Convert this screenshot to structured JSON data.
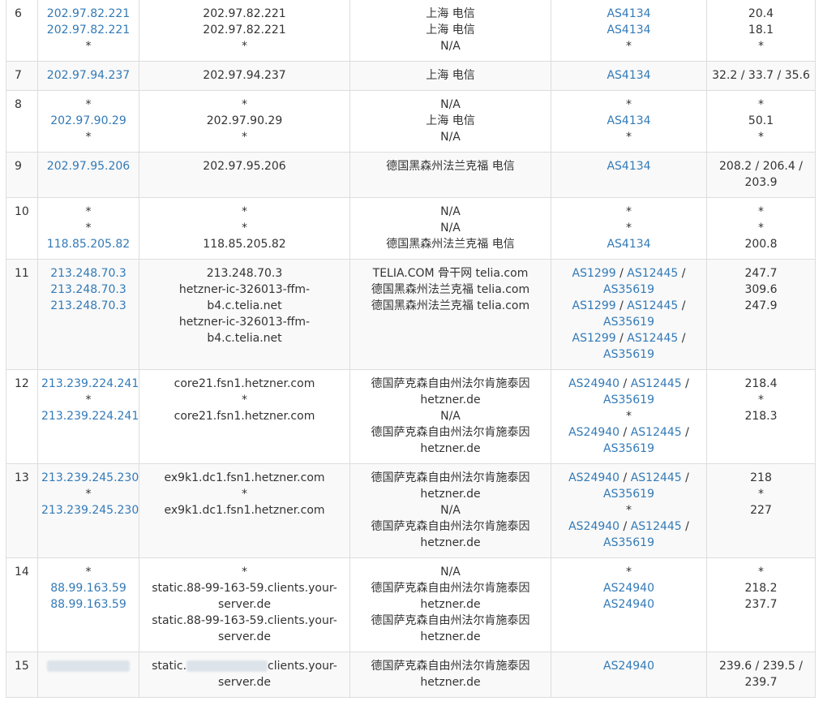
{
  "rows": [
    {
      "hop": "6",
      "ip": [
        {
          "t": "202.97.82.221",
          "link": true
        },
        {
          "t": "202.97.82.221",
          "link": true
        },
        {
          "t": "*"
        }
      ],
      "host": [
        "202.97.82.221",
        "202.97.82.221",
        "*"
      ],
      "loc": [
        "上海 电信",
        "上海 电信",
        "N/A"
      ],
      "asn": [
        [
          {
            "t": "AS4134",
            "link": true
          }
        ],
        [
          {
            "t": "AS4134",
            "link": true
          }
        ],
        [
          {
            "t": "*"
          }
        ]
      ],
      "time": [
        "20.4",
        "18.1",
        "*"
      ]
    },
    {
      "hop": "7",
      "ip": [
        {
          "t": "202.97.94.237",
          "link": true
        }
      ],
      "host": [
        "202.97.94.237"
      ],
      "loc": [
        "上海 电信"
      ],
      "asn": [
        [
          {
            "t": "AS4134",
            "link": true
          }
        ]
      ],
      "time": [
        "32.2 / 33.7 / 35.6"
      ]
    },
    {
      "hop": "8",
      "ip": [
        {
          "t": "*"
        },
        {
          "t": "202.97.90.29",
          "link": true
        },
        {
          "t": "*"
        }
      ],
      "host": [
        "*",
        "202.97.90.29",
        "*"
      ],
      "loc": [
        "N/A",
        "上海 电信",
        "N/A"
      ],
      "asn": [
        [
          {
            "t": "*"
          }
        ],
        [
          {
            "t": "AS4134",
            "link": true
          }
        ],
        [
          {
            "t": "*"
          }
        ]
      ],
      "time": [
        "*",
        "50.1",
        "*"
      ]
    },
    {
      "hop": "9",
      "ip": [
        {
          "t": "202.97.95.206",
          "link": true
        }
      ],
      "host": [
        "202.97.95.206"
      ],
      "loc": [
        "德国黑森州法兰克福 电信"
      ],
      "asn": [
        [
          {
            "t": "AS4134",
            "link": true
          }
        ]
      ],
      "time": [
        "208.2 / 206.4 /",
        "203.9"
      ]
    },
    {
      "hop": "10",
      "ip": [
        {
          "t": "*"
        },
        {
          "t": "*"
        },
        {
          "t": "118.85.205.82",
          "link": true
        }
      ],
      "host": [
        "*",
        "*",
        "118.85.205.82"
      ],
      "loc": [
        "N/A",
        "N/A",
        "德国黑森州法兰克福 电信"
      ],
      "asn": [
        [
          {
            "t": "*"
          }
        ],
        [
          {
            "t": "*"
          }
        ],
        [
          {
            "t": "AS4134",
            "link": true
          }
        ]
      ],
      "time": [
        "*",
        "*",
        "200.8"
      ]
    },
    {
      "hop": "11",
      "ip": [
        {
          "t": "213.248.70.3",
          "link": true
        },
        {
          "t": "213.248.70.3",
          "link": true
        },
        {
          "t": "213.248.70.3",
          "link": true
        }
      ],
      "host": [
        "213.248.70.3",
        "hetzner-ic-326013-ffm-b4.c.telia.net",
        "hetzner-ic-326013-ffm-b4.c.telia.net"
      ],
      "loc": [
        "TELIA.COM 骨干网 telia.com",
        "德国黑森州法兰克福 telia.com",
        "德国黑森州法兰克福 telia.com"
      ],
      "asn": [
        [
          {
            "t": "AS1299",
            "link": true
          },
          {
            "t": " / "
          },
          {
            "t": "AS12445",
            "link": true
          },
          {
            "t": " /"
          }
        ],
        [
          {
            "t": "AS35619",
            "link": true
          }
        ],
        [
          {
            "t": "AS1299",
            "link": true
          },
          {
            "t": " / "
          },
          {
            "t": "AS12445",
            "link": true
          },
          {
            "t": " /"
          }
        ],
        [
          {
            "t": "AS35619",
            "link": true
          }
        ],
        [
          {
            "t": "AS1299",
            "link": true
          },
          {
            "t": " / "
          },
          {
            "t": "AS12445",
            "link": true
          },
          {
            "t": " /"
          }
        ],
        [
          {
            "t": "AS35619",
            "link": true
          }
        ]
      ],
      "time": [
        "247.7",
        "309.6",
        "247.9"
      ]
    },
    {
      "hop": "12",
      "ip": [
        {
          "t": "213.239.224.241",
          "link": true
        },
        {
          "t": "*"
        },
        {
          "t": "213.239.224.241",
          "link": true
        }
      ],
      "host": [
        "core21.fsn1.hetzner.com",
        "*",
        "core21.fsn1.hetzner.com"
      ],
      "loc": [
        "德国萨克森自由州法尔肯施泰因",
        "hetzner.de",
        "N/A",
        "德国萨克森自由州法尔肯施泰因",
        "hetzner.de"
      ],
      "asn": [
        [
          {
            "t": "AS24940",
            "link": true
          },
          {
            "t": " / "
          },
          {
            "t": "AS12445",
            "link": true
          },
          {
            "t": " /"
          }
        ],
        [
          {
            "t": "AS35619",
            "link": true
          }
        ],
        [
          {
            "t": "*"
          }
        ],
        [
          {
            "t": "AS24940",
            "link": true
          },
          {
            "t": " / "
          },
          {
            "t": "AS12445",
            "link": true
          },
          {
            "t": " /"
          }
        ],
        [
          {
            "t": "AS35619",
            "link": true
          }
        ]
      ],
      "time": [
        "218.4",
        "*",
        "218.3"
      ]
    },
    {
      "hop": "13",
      "ip": [
        {
          "t": "213.239.245.230",
          "link": true
        },
        {
          "t": "*"
        },
        {
          "t": "213.239.245.230",
          "link": true
        }
      ],
      "host": [
        "ex9k1.dc1.fsn1.hetzner.com",
        "*",
        "ex9k1.dc1.fsn1.hetzner.com"
      ],
      "loc": [
        "德国萨克森自由州法尔肯施泰因",
        "hetzner.de",
        "N/A",
        "德国萨克森自由州法尔肯施泰因",
        "hetzner.de"
      ],
      "asn": [
        [
          {
            "t": "AS24940",
            "link": true
          },
          {
            "t": " / "
          },
          {
            "t": "AS12445",
            "link": true
          },
          {
            "t": " /"
          }
        ],
        [
          {
            "t": "AS35619",
            "link": true
          }
        ],
        [
          {
            "t": "*"
          }
        ],
        [
          {
            "t": "AS24940",
            "link": true
          },
          {
            "t": " / "
          },
          {
            "t": "AS12445",
            "link": true
          },
          {
            "t": " /"
          }
        ],
        [
          {
            "t": "AS35619",
            "link": true
          }
        ]
      ],
      "time": [
        "218",
        "*",
        "227"
      ]
    },
    {
      "hop": "14",
      "ip": [
        {
          "t": "*"
        },
        {
          "t": "88.99.163.59",
          "link": true
        },
        {
          "t": "88.99.163.59",
          "link": true
        }
      ],
      "host": [
        "*",
        "static.88-99-163-59.clients.your-",
        "server.de",
        "static.88-99-163-59.clients.your-",
        "server.de"
      ],
      "loc": [
        "N/A",
        "德国萨克森自由州法尔肯施泰因",
        "hetzner.de",
        "德国萨克森自由州法尔肯施泰因",
        "hetzner.de"
      ],
      "asn": [
        [
          {
            "t": "*"
          }
        ],
        [
          {
            "t": "AS24940",
            "link": true
          }
        ],
        [
          {
            "t": "AS24940",
            "link": true
          }
        ]
      ],
      "time": [
        "*",
        "218.2",
        "237.7"
      ]
    },
    {
      "hop": "15",
      "ip": [
        {
          "blur": "ip"
        }
      ],
      "host_blur": {
        "pre": "static.",
        "post": "clients.your-",
        "line2": "server.de"
      },
      "loc": [
        "德国萨克森自由州法尔肯施泰因",
        "hetzner.de"
      ],
      "asn": [
        [
          {
            "t": "AS24940",
            "link": true
          }
        ]
      ],
      "time": [
        "239.6 / 239.5 /",
        "239.7"
      ]
    }
  ]
}
